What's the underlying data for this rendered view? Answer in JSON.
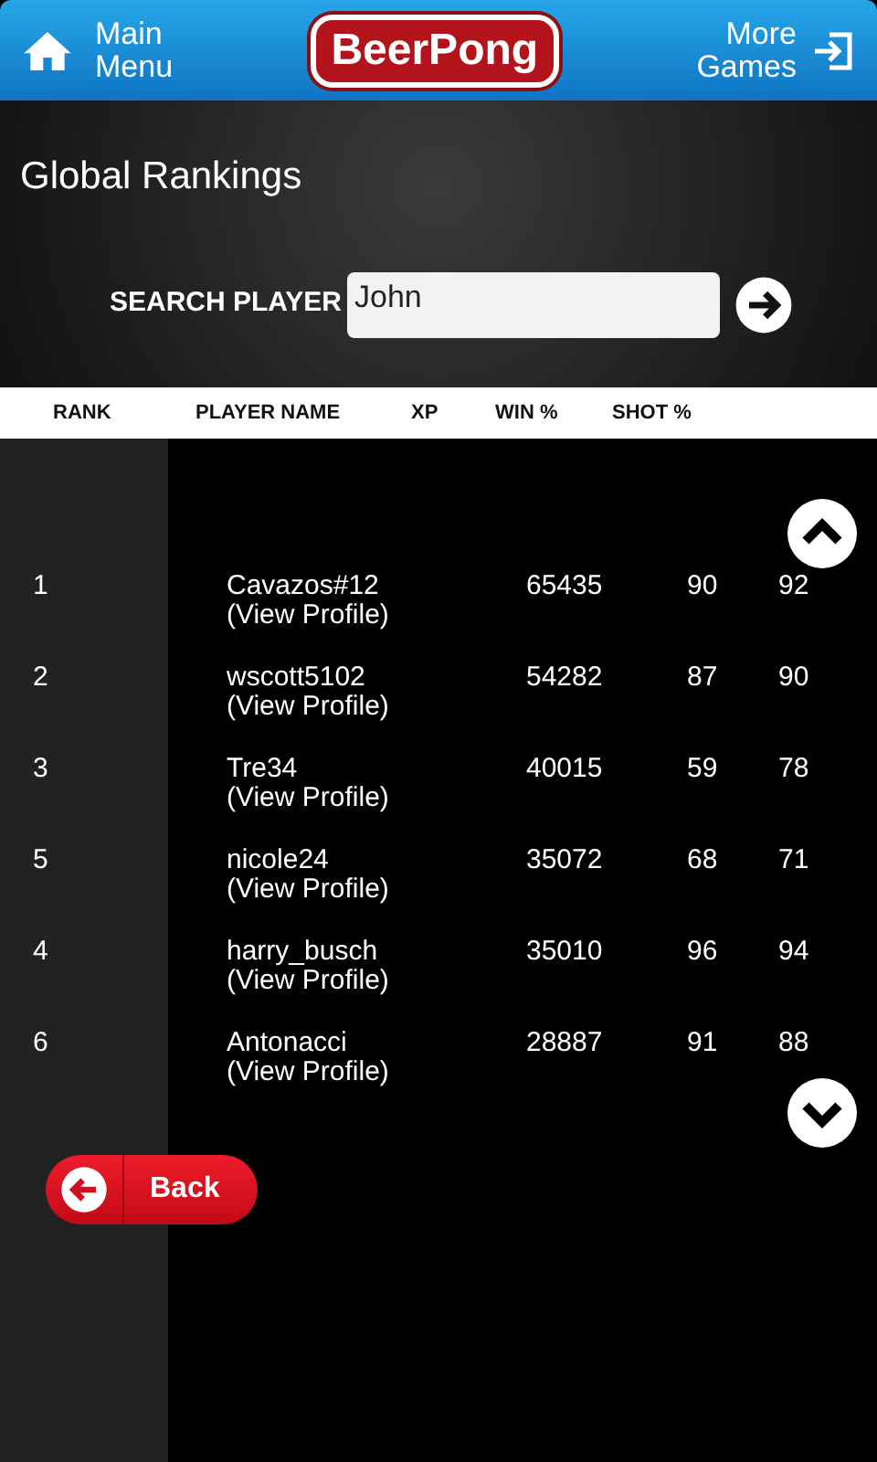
{
  "header": {
    "main_menu": "Main\nMenu",
    "logo": "BeerPong",
    "more_games": "More\nGames"
  },
  "title": "Global Rankings",
  "search": {
    "label": "SEARCH PLAYER",
    "value": "John"
  },
  "table": {
    "columns": [
      "RANK",
      "PLAYER NAME",
      "XP",
      "WIN %",
      "SHOT %"
    ],
    "rows": [
      {
        "rank": "1",
        "name": "Cavazos#12",
        "link": "(View Profile)",
        "xp": "65435",
        "win": "90",
        "shot": "92"
      },
      {
        "rank": "2",
        "name": "wscott5102",
        "link": "(View Profile)",
        "xp": "54282",
        "win": "87",
        "shot": "90"
      },
      {
        "rank": "3",
        "name": "Tre34",
        "link": "(View Profile)",
        "xp": "40015",
        "win": "59",
        "shot": "78"
      },
      {
        "rank": "5",
        "name": "nicole24",
        "link": "(View Profile)",
        "xp": "35072",
        "win": "68",
        "shot": "71"
      },
      {
        "rank": "4",
        "name": "harry_busch",
        "link": "(View Profile)",
        "xp": "35010",
        "win": "96",
        "shot": "94"
      },
      {
        "rank": "6",
        "name": "Antonacci",
        "link": "(View Profile)",
        "xp": "28887",
        "win": "91",
        "shot": "88"
      }
    ]
  },
  "back_button": "Back"
}
